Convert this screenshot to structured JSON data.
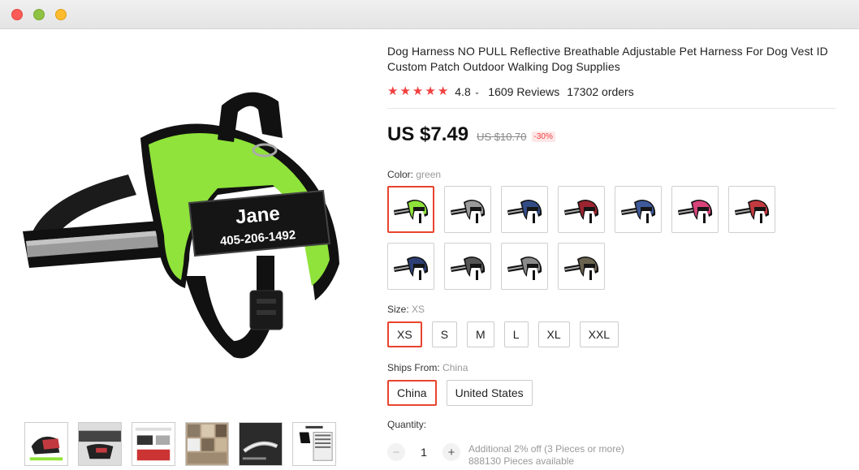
{
  "window": {
    "controls": [
      "close",
      "minimize",
      "zoom"
    ]
  },
  "product": {
    "title": "Dog Harness NO PULL Reflective Breathable Adjustable Pet Harness For Dog Vest ID Custom Patch Outdoor Walking Dog Supplies",
    "rating": "4.8",
    "stars": 5,
    "reviews": "1609 Reviews",
    "orders": "17302 orders",
    "price": "US $7.49",
    "original_price": "US $10.70",
    "discount": "-30%",
    "image_patch": {
      "name": "Jane",
      "phone": "405-206-1492"
    }
  },
  "color": {
    "label": "Color:",
    "selected": "green",
    "swatches": [
      {
        "name": "green",
        "hex": "#8fe33a"
      },
      {
        "name": "gray",
        "hex": "#9a9a9a"
      },
      {
        "name": "blue",
        "hex": "#334c86"
      },
      {
        "name": "red",
        "hex": "#9b2430"
      },
      {
        "name": "blue-2",
        "hex": "#3e5a9a"
      },
      {
        "name": "pink",
        "hex": "#d8437a"
      },
      {
        "name": "red-2",
        "hex": "#c23a3f"
      },
      {
        "name": "navy",
        "hex": "#2d3f75"
      },
      {
        "name": "dark-gray",
        "hex": "#555555"
      },
      {
        "name": "silver",
        "hex": "#8a8a8a"
      },
      {
        "name": "camo",
        "hex": "#6b6450"
      }
    ]
  },
  "size": {
    "label": "Size:",
    "selected": "XS",
    "options": [
      "XS",
      "S",
      "M",
      "L",
      "XL",
      "XXL"
    ]
  },
  "ships": {
    "label": "Ships From:",
    "selected": "China",
    "options": [
      "China",
      "United States"
    ]
  },
  "quantity": {
    "label": "Quantity:",
    "value": "1",
    "minus": "−",
    "plus": "+",
    "promo": "Additional 2% off (3 Pieces or more)",
    "available": "888130 Pieces available"
  },
  "colors": {
    "accent": "#e8442e",
    "star": "#f23f3f"
  }
}
